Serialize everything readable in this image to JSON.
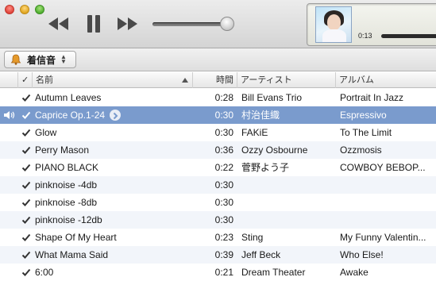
{
  "player": {
    "controls": {
      "rewind_icon": "rewind-icon",
      "pause_icon": "pause-icon",
      "forward_icon": "fast-forward-icon"
    },
    "volume": {
      "level": 0.92
    },
    "now_playing": {
      "elapsed": "0:13",
      "artwork": "album-artwork"
    }
  },
  "source": {
    "label": "着信音",
    "icon": "bell-icon"
  },
  "table": {
    "headers": {
      "name": "名前",
      "time": "時間",
      "artist": "アーティスト",
      "album": "アルバム"
    },
    "sorted_by": "name",
    "rows": [
      {
        "checked": true,
        "name": "Autumn Leaves",
        "time": "0:28",
        "artist": "Bill Evans Trio",
        "album": "Portrait In Jazz"
      },
      {
        "checked": true,
        "name": "Caprice Op.1-24",
        "time": "0:30",
        "artist": "村治佳織",
        "album": "Espressivo",
        "playing": true,
        "selected": true
      },
      {
        "checked": true,
        "name": "Glow",
        "time": "0:30",
        "artist": "FAKiE",
        "album": "To The Limit"
      },
      {
        "checked": true,
        "name": "Perry Mason",
        "time": "0:36",
        "artist": "Ozzy Osbourne",
        "album": "Ozzmosis"
      },
      {
        "checked": true,
        "name": "PIANO BLACK",
        "time": "0:22",
        "artist": "菅野よう子",
        "album": "COWBOY BEBOP..."
      },
      {
        "checked": true,
        "name": "pinknoise -4db",
        "time": "0:30",
        "artist": "",
        "album": ""
      },
      {
        "checked": true,
        "name": "pinknoise -8db",
        "time": "0:30",
        "artist": "",
        "album": ""
      },
      {
        "checked": true,
        "name": "pinknoise -12db",
        "time": "0:30",
        "artist": "",
        "album": ""
      },
      {
        "checked": true,
        "name": "Shape Of My Heart",
        "time": "0:23",
        "artist": "Sting",
        "album": "My Funny Valentin..."
      },
      {
        "checked": true,
        "name": "What Mama Said",
        "time": "0:39",
        "artist": "Jeff Beck",
        "album": "Who Else!"
      },
      {
        "checked": true,
        "name": "6:00",
        "time": "0:21",
        "artist": "Dream Theater",
        "album": "Awake"
      }
    ]
  },
  "colors": {
    "selection": "#7a9bcd",
    "alt_row": "#f2f5fa"
  }
}
